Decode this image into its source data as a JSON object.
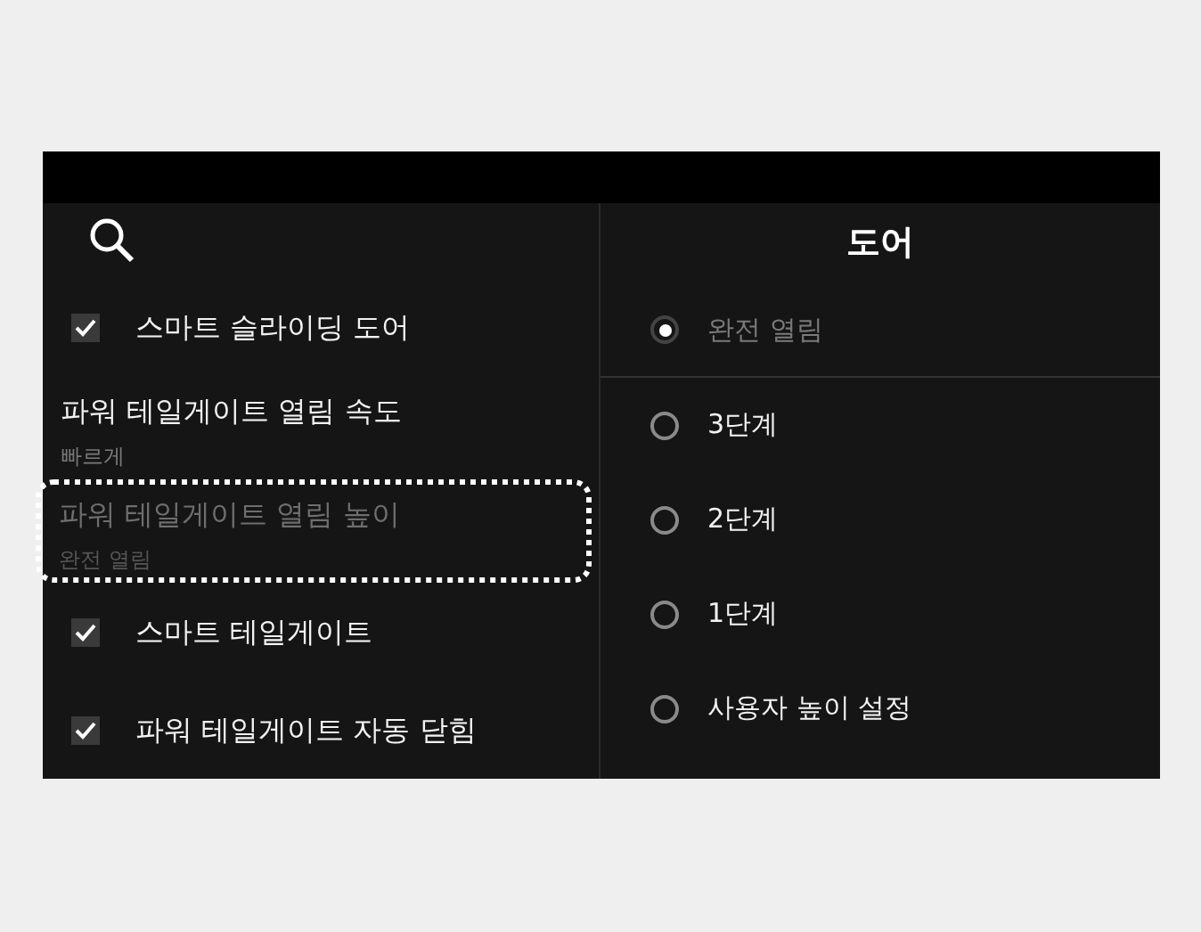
{
  "header": {
    "title": "도어"
  },
  "settings": [
    {
      "kind": "check",
      "label": "스마트 슬라이딩 도어",
      "checked": true
    },
    {
      "kind": "value",
      "label": "파워 테일게이트 열림 속도",
      "value": "빠르게",
      "highlighted": false
    },
    {
      "kind": "value",
      "label": "파워 테일게이트 열림 높이",
      "value": "완전 열림",
      "highlighted": true
    },
    {
      "kind": "check",
      "label": "스마트 테일게이트",
      "checked": true
    },
    {
      "kind": "check",
      "label": "파워 테일게이트 자동 닫힘",
      "checked": true
    }
  ],
  "options": [
    {
      "label": "완전 열림",
      "selected": true
    },
    {
      "label": "3단계",
      "selected": false
    },
    {
      "label": "2단계",
      "selected": false
    },
    {
      "label": "1단계",
      "selected": false
    },
    {
      "label": "사용자 높이 설정",
      "selected": false
    }
  ]
}
